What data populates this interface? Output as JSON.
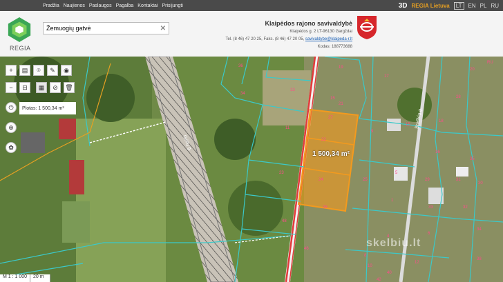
{
  "topbar": {
    "nav": [
      "Pradžia",
      "Naujienos",
      "Paslaugos",
      "Pagalba",
      "Kontaktai",
      "Prisijungti"
    ],
    "badge_3d": "3D",
    "regia_lt": "REGIA Lietuva",
    "languages": [
      "LT",
      "EN",
      "PL",
      "RU"
    ],
    "active_language": "LT"
  },
  "logo": {
    "text": "REGIA"
  },
  "search": {
    "value": "Žemuogių gatvė"
  },
  "institution": {
    "name": "Klaipėdos rajono savivaldybė",
    "address": "Klaipėdos g. 2 LT-96130 Gargždai",
    "phone_prefix": "Tel. (8 46) 47 20 25, Faks. (8 46) 47 20 05,",
    "email": "savivaldybe@klaipeda-r.lt",
    "code": "Kodas: 188773688"
  },
  "map": {
    "area_label": "Plotas: 1 500,34 m²",
    "area_on_map": "1 500,34 m²",
    "street_labels": [
      "Gėlių g.",
      "Braškių g."
    ],
    "parcel_numbers": [
      "1",
      "4",
      "5",
      "6",
      "8",
      "9",
      "10",
      "11",
      "12",
      "13",
      "15",
      "16",
      "17",
      "18",
      "19",
      "20",
      "21",
      "22",
      "23",
      "24",
      "25",
      "26",
      "27",
      "28",
      "29",
      "30",
      "31",
      "32",
      "33",
      "34",
      "35",
      "36",
      "38",
      "40",
      "42",
      "46",
      "48"
    ],
    "scale_ratio": "M 1 : 1 000",
    "scale_bar": "20 m",
    "watermark": "skelbiu.lt"
  },
  "tools": {
    "zoom_in": "+",
    "zoom_out": "−"
  },
  "colors": {
    "topbar": "#4a4a4a",
    "accent": "#e7a022",
    "parcel_lines": "#3bc9c9",
    "selection": "#f39a1e",
    "road": "#e23b3b"
  }
}
